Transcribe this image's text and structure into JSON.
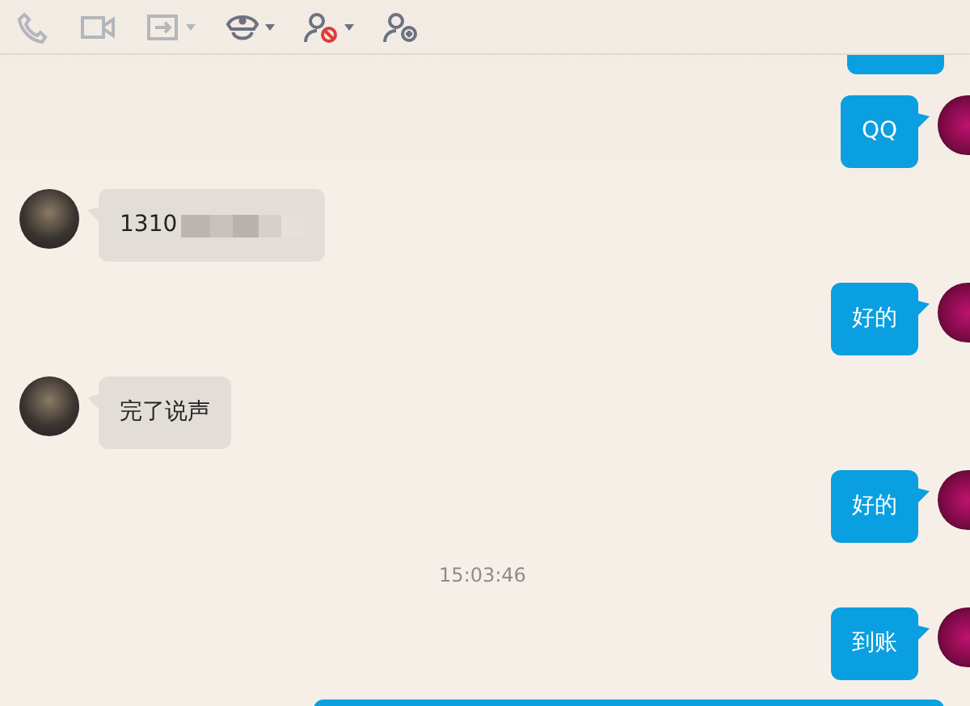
{
  "toolbar": {
    "tools": [
      {
        "kind": "phone",
        "disabled": true,
        "menu": false
      },
      {
        "kind": "video",
        "disabled": true,
        "menu": false
      },
      {
        "kind": "share",
        "disabled": true,
        "menu": true
      },
      {
        "kind": "police",
        "disabled": false,
        "menu": true
      },
      {
        "kind": "block",
        "disabled": false,
        "menu": true
      },
      {
        "kind": "add-user",
        "disabled": false,
        "menu": false
      }
    ]
  },
  "messages": [
    {
      "kind": "sent-clipped-top"
    },
    {
      "kind": "sent",
      "text": "QQ"
    },
    {
      "kind": "received",
      "text": "1310",
      "redacted": true
    },
    {
      "kind": "sent",
      "text": "好的"
    },
    {
      "kind": "received",
      "text": "完了说声",
      "redacted": false
    },
    {
      "kind": "sent",
      "text": "好的"
    },
    {
      "kind": "time",
      "text": "15:03:46"
    },
    {
      "kind": "sent",
      "text": "到账"
    },
    {
      "kind": "sent-clipped-bottom"
    }
  ]
}
